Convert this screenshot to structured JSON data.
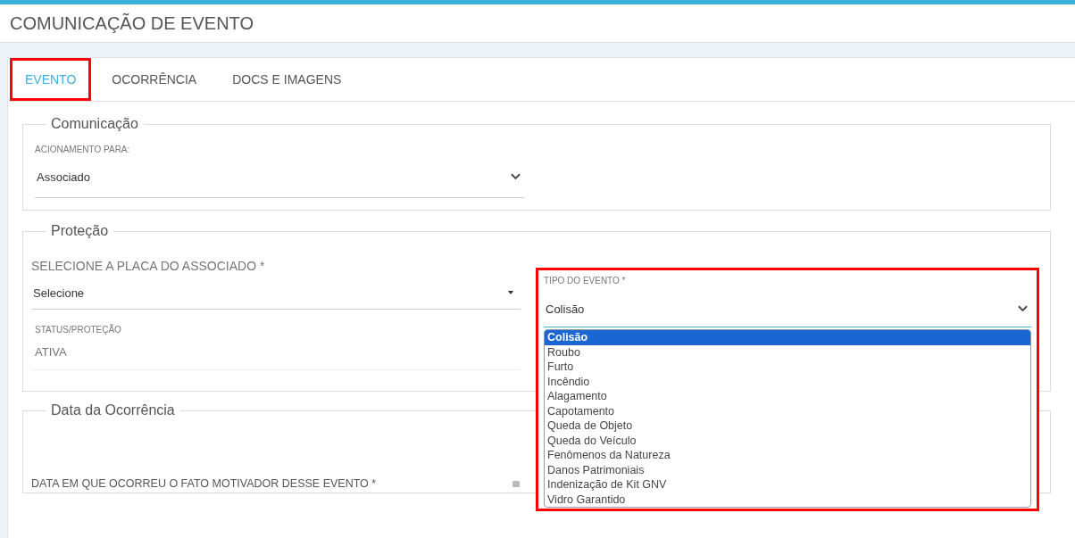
{
  "page": {
    "title": "COMUNICAÇÃO DE EVENTO"
  },
  "tabs": [
    {
      "label": "EVENTO",
      "selected": true,
      "highlighted": true
    },
    {
      "label": "OCORRÊNCIA",
      "selected": false,
      "highlighted": false
    },
    {
      "label": "DOCS E IMAGENS",
      "selected": false,
      "highlighted": false
    }
  ],
  "comunicacao": {
    "legend": "Comunicação",
    "field": {
      "label": "ACIONAMENTO PARA:",
      "value": "Associado"
    }
  },
  "protecao": {
    "legend": "Proteção",
    "placa": {
      "label": "SELECIONE A PLACA DO ASSOCIADO *",
      "value": "Selecione"
    },
    "status": {
      "label": "STATUS/PROTEÇÃO",
      "value": "ATIVA"
    },
    "tipo": {
      "label": "TIPO DO EVENTO *",
      "value": "Colisão",
      "highlighted": true,
      "expanded": true,
      "options": [
        {
          "label": "Colisão",
          "selected": true
        },
        {
          "label": "Roubo",
          "selected": false
        },
        {
          "label": "Furto",
          "selected": false
        },
        {
          "label": "Incêndio",
          "selected": false
        },
        {
          "label": "Alagamento",
          "selected": false
        },
        {
          "label": "Capotamento",
          "selected": false
        },
        {
          "label": "Queda de Objeto",
          "selected": false
        },
        {
          "label": "Queda do Veículo",
          "selected": false
        },
        {
          "label": "Fenômenos da Natureza",
          "selected": false
        },
        {
          "label": "Danos Patrimoniais",
          "selected": false
        },
        {
          "label": "Indenização de Kit GNV",
          "selected": false
        },
        {
          "label": "Vidro Garantido",
          "selected": false
        }
      ]
    }
  },
  "data_ocorrencia": {
    "legend": "Data da Ocorrência",
    "field": {
      "label": "DATA EM QUE OCORREU O FATO MOTIVADOR DESSE EVENTO *"
    }
  }
}
